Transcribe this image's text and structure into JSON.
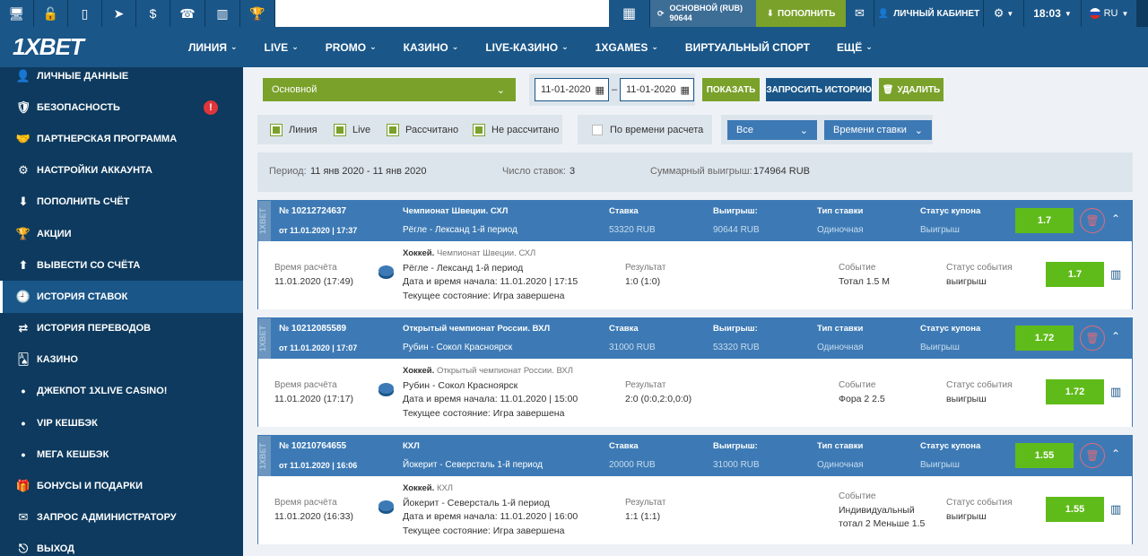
{
  "topbar": {
    "icons": [
      "desktop-icon",
      "lock-icon",
      "mobile-icon",
      "telegram-icon",
      "dollar-icon",
      "phone-icon",
      "chart-icon",
      "trophy-icon"
    ],
    "balance_label": "ОСНОВНОЙ (RUB)",
    "balance_value": "90644",
    "deposit_label": "ПОПОЛНИТЬ",
    "cabinet_label": "ЛИЧНЫЙ КАБИНЕТ",
    "time": "18:03",
    "lang": "RU"
  },
  "nav": {
    "logo": "1XBET",
    "items": [
      "ЛИНИЯ",
      "LIVE",
      "PROMO",
      "КАЗИНО",
      "LIVE-КАЗИНО",
      "1XGAMES",
      "ВИРТУАЛЬНЫЙ СПОРТ",
      "ЕЩЁ"
    ]
  },
  "sidebar": {
    "items": [
      {
        "label": "ЛИЧНЫЕ ДАННЫЕ",
        "icon": "user-icon"
      },
      {
        "label": "БЕЗОПАСНОСТЬ",
        "icon": "shield-icon",
        "alert": "!"
      },
      {
        "label": "ПАРТНЕРСКАЯ ПРОГРАММА",
        "icon": "handshake-icon"
      },
      {
        "label": "НАСТРОЙКИ АККАУНТА",
        "icon": "gears-icon"
      },
      {
        "label": "ПОПОЛНИТЬ СЧЁТ",
        "icon": "download-icon"
      },
      {
        "label": "АКЦИИ",
        "icon": "trophy-icon"
      },
      {
        "label": "ВЫВЕСТИ СО СЧЁТА",
        "icon": "upload-icon"
      },
      {
        "label": "ИСТОРИЯ СТАВОК",
        "icon": "clock-icon"
      },
      {
        "label": "ИСТОРИЯ ПЕРЕВОДОВ",
        "icon": "transfer-icon"
      },
      {
        "label": "КАЗИНО",
        "icon": "cards-icon"
      },
      {
        "label": "ДЖЕКПОТ 1XLIVE CASINO!",
        "icon": "bullet"
      },
      {
        "label": "VIP КЕШБЭК",
        "icon": "bullet"
      },
      {
        "label": "МЕГА КЕШБЭК",
        "icon": "bullet"
      },
      {
        "label": "БОНУСЫ И ПОДАРКИ",
        "icon": "gift-icon"
      },
      {
        "label": "ЗАПРОС АДМИНИСТРАТОРУ",
        "icon": "envelope-icon"
      },
      {
        "label": "ВЫХОД",
        "icon": "exit-icon"
      }
    ]
  },
  "filters": {
    "account_select": "Основной",
    "date_from": "11-01-2020",
    "date_sep": "–",
    "date_to": "11-01-2020",
    "show_btn": "ПОКАЗАТЬ",
    "request_btn": "ЗАПРОСИТЬ ИСТОРИЮ",
    "delete_btn": "УДАЛИТЬ",
    "chk_line": "Линия",
    "chk_live": "Live",
    "chk_settled": "Рассчитано",
    "chk_unsettled": "Не рассчитано",
    "chk_by_time": "По времени расчета",
    "dd_all": "Все",
    "dd_time": "Времени ставки"
  },
  "summary": {
    "period_label": "Период:",
    "period_value": "11 янв 2020 - 11 янв 2020",
    "count_label": "Число ставок:",
    "count_value": "3",
    "total_label": "Суммарный выигрыш:",
    "total_value": "174964 RUB"
  },
  "labels": {
    "stake": "Ставка",
    "win": "Выигрыш:",
    "bet_type": "Тип ставки",
    "coupon_status": "Статус купона",
    "calc_time": "Время расчёта",
    "result": "Результат",
    "event": "Событие",
    "event_status": "Статус события",
    "brand_strip": "1XBET"
  },
  "bets": [
    {
      "number": "№ 10212724637",
      "date": "от 11.01.2020 | 17:37",
      "league": "Чемпионат Швеции. СХЛ",
      "match": "Рёгле - Лександ 1-й период",
      "stake": "53320 RUB",
      "win": "90644 RUB",
      "type": "Одиночная",
      "status": "Выигрыш",
      "odds": "1.7",
      "calc_time": "11.01.2020 (17:49)",
      "sport": "Хоккей.",
      "sport_league": "Чемпионат Швеции. СХЛ",
      "event_match": "Рёгле - Лександ 1-й период",
      "start": "Дата и время начала: 11.01.2020 | 17:15",
      "state": "Текущее состояние: Игра завершена",
      "result": "1:0 (1:0)",
      "event_line1": "Тотал 1.5 М",
      "event_line2": "",
      "event_status": "выигрыш"
    },
    {
      "number": "№ 10212085589",
      "date": "от 11.01.2020 | 17:07",
      "league": "Открытый чемпионат России. ВХЛ",
      "match": "Рубин - Сокол Красноярск",
      "stake": "31000 RUB",
      "win": "53320 RUB",
      "type": "Одиночная",
      "status": "Выигрыш",
      "odds": "1.72",
      "calc_time": "11.01.2020 (17:17)",
      "sport": "Хоккей.",
      "sport_league": "Открытый чемпионат России. ВХЛ",
      "event_match": "Рубин - Сокол Красноярск",
      "start": "Дата и время начала: 11.01.2020 | 15:00",
      "state": "Текущее состояние: Игра завершена",
      "result": "2:0 (0:0,2:0,0:0)",
      "event_line1": "Фора 2 2.5",
      "event_line2": "",
      "event_status": "выигрыш"
    },
    {
      "number": "№ 10210764655",
      "date": "от 11.01.2020 | 16:06",
      "league": "КХЛ",
      "match": "Йокерит - Северсталь 1-й период",
      "stake": "20000 RUB",
      "win": "31000 RUB",
      "type": "Одиночная",
      "status": "Выигрыш",
      "odds": "1.55",
      "calc_time": "11.01.2020 (16:33)",
      "sport": "Хоккей.",
      "sport_league": "КХЛ",
      "event_match": "Йокерит - Северсталь 1-й период",
      "start": "Дата и время начала: 11.01.2020 | 16:00",
      "state": "Текущее состояние: Игра завершена",
      "result": "1:1 (1:1)",
      "event_line1": "Индивидуальный",
      "event_line2": "тотал 2 Меньше 1.5",
      "event_status": "выигрыш"
    }
  ]
}
